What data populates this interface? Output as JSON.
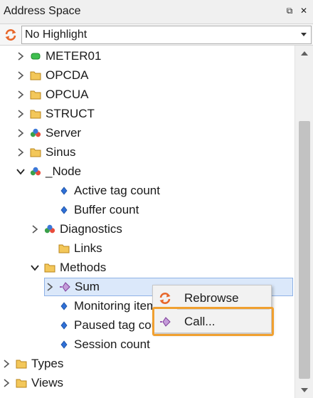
{
  "panel": {
    "title": "Address Space",
    "pin_glyph": "⧉",
    "close_glyph": "✕"
  },
  "toolbar": {
    "refresh_icon": "refresh-icon",
    "highlight_value": "No Highlight"
  },
  "tree": {
    "nodes": [
      {
        "label": "METER01",
        "icon": "tag-green-icon",
        "expander": "collapsed"
      },
      {
        "label": "OPCDA",
        "icon": "folder-icon",
        "expander": "collapsed"
      },
      {
        "label": "OPCUA",
        "icon": "folder-icon",
        "expander": "collapsed"
      },
      {
        "label": "STRUCT",
        "icon": "folder-icon",
        "expander": "collapsed"
      },
      {
        "label": "Server",
        "icon": "object-icon",
        "expander": "collapsed"
      },
      {
        "label": "Sinus",
        "icon": "folder-icon",
        "expander": "collapsed"
      },
      {
        "label": "_Node",
        "icon": "object-icon",
        "expander": "expanded"
      },
      {
        "label": "Active tag count",
        "icon": "variable-icon",
        "expander": "none"
      },
      {
        "label": "Buffer count",
        "icon": "variable-icon",
        "expander": "none"
      },
      {
        "label": "Diagnostics",
        "icon": "object-icon",
        "expander": "collapsed"
      },
      {
        "label": "Links",
        "icon": "folder-icon",
        "expander": "none"
      },
      {
        "label": "Methods",
        "icon": "folder-icon",
        "expander": "expanded"
      },
      {
        "label": "Sum",
        "icon": "method-icon",
        "expander": "collapsed",
        "selected": true
      },
      {
        "label": "Monitoring item",
        "icon": "variable-icon",
        "expander": "none"
      },
      {
        "label": "Paused tag coun",
        "icon": "variable-icon",
        "expander": "none"
      },
      {
        "label": "Session count",
        "icon": "variable-icon",
        "expander": "none"
      },
      {
        "label": "Types",
        "icon": "folder-icon",
        "expander": "collapsed"
      },
      {
        "label": "Views",
        "icon": "folder-icon",
        "expander": "collapsed"
      }
    ]
  },
  "context_menu": {
    "items": [
      {
        "label": "Rebrowse",
        "icon": "refresh-icon"
      },
      {
        "label": "Call...",
        "icon": "method-icon",
        "highlighted": true
      }
    ]
  },
  "colors": {
    "accent_orange": "#f0a030",
    "selection": "#dbe8fa",
    "folder": "#f3c75a"
  }
}
